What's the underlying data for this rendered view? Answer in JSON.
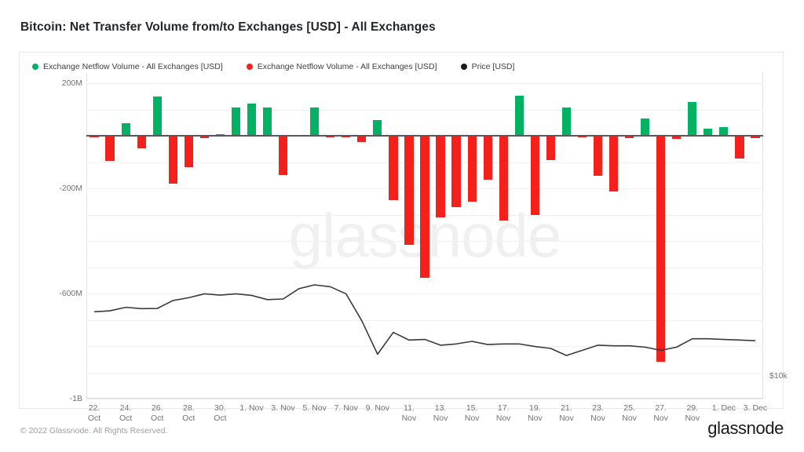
{
  "title": "Bitcoin: Net Transfer Volume from/to Exchanges [USD] - All Exchanges",
  "footer": {
    "copyright": "© 2022 Glassnode. All Rights Reserved.",
    "logo": "glassnode"
  },
  "watermark": "glassnode",
  "legend": [
    {
      "label": "Exchange Netflow Volume - All Exchanges [USD]",
      "color": "#00b262",
      "marker": "circle-dot-icon"
    },
    {
      "label": "Exchange Netflow Volume - All Exchanges [USD]",
      "color": "#f4201c",
      "marker": "circle-dot-icon"
    },
    {
      "label": "Price [USD]",
      "color": "#1c1c1c",
      "marker": "circle-dot-icon"
    }
  ],
  "chart_data": {
    "type": "bar",
    "title": "Bitcoin: Net Transfer Volume from/to Exchanges [USD] - All Exchanges",
    "xlabel": "",
    "ylabel": "",
    "grid": true,
    "legend_position": "top-left",
    "colors": {
      "positive": "#00b262",
      "negative": "#f4201c",
      "price": "#3a3a3a"
    },
    "y_axis": {
      "tick_labels": [
        "200M",
        "-200M",
        "-600M",
        "-1B"
      ],
      "tick_values": [
        200000000,
        -200000000,
        -600000000,
        -1000000000
      ],
      "gridline_values": [
        200000000,
        100000000,
        0,
        -100000000,
        -200000000,
        -300000000,
        -400000000,
        -500000000,
        -600000000,
        -700000000,
        -800000000,
        -900000000,
        -1000000000
      ],
      "ylim": [
        -1000000000,
        240000000
      ],
      "unit": "USD"
    },
    "y_axis_right": {
      "tick_labels": [
        "$10k"
      ],
      "tick_values": [
        10000
      ],
      "unit": "USD",
      "series_name": "Price [USD]"
    },
    "x_axis": {
      "tick_labels": [
        "22. Oct",
        "24. Oct",
        "26. Oct",
        "28. Oct",
        "30. Oct",
        "1. Nov",
        "3. Nov",
        "5. Nov",
        "7. Nov",
        "9. Nov",
        "11. Nov",
        "13. Nov",
        "15. Nov",
        "17. Nov",
        "19. Nov",
        "21. Nov",
        "23. Nov",
        "25. Nov",
        "27. Nov",
        "29. Nov",
        "1. Dec",
        "3. Dec"
      ],
      "tick_indices": [
        0,
        2,
        4,
        6,
        8,
        10,
        12,
        14,
        16,
        18,
        20,
        22,
        24,
        26,
        28,
        30,
        32,
        34,
        36,
        38,
        40,
        42
      ]
    },
    "categories": [
      "22. Oct",
      "23. Oct",
      "24. Oct",
      "25. Oct",
      "26. Oct",
      "27. Oct",
      "28. Oct",
      "29. Oct",
      "30. Oct",
      "31. Oct",
      "1. Nov",
      "2. Nov",
      "3. Nov",
      "4. Nov",
      "5. Nov",
      "6. Nov",
      "7. Nov",
      "8. Nov",
      "9. Nov",
      "10. Nov",
      "11. Nov",
      "12. Nov",
      "13. Nov",
      "14. Nov",
      "15. Nov",
      "16. Nov",
      "17. Nov",
      "18. Nov",
      "19. Nov",
      "20. Nov",
      "21. Nov",
      "22. Nov",
      "23. Nov",
      "24. Nov",
      "25. Nov",
      "26. Nov",
      "27. Nov",
      "28. Nov",
      "29. Nov",
      "30. Nov",
      "1. Dec",
      "2. Dec",
      "3. Dec"
    ],
    "series": [
      {
        "name": "Exchange Netflow Volume - All Exchanges [USD]",
        "type": "bar",
        "values": [
          -2000000,
          -95000000,
          48000000,
          -48000000,
          150000000,
          -182000000,
          -120000000,
          -8000000,
          7000000,
          108000000,
          122000000,
          108000000,
          -148000000,
          4000000,
          108000000,
          -4000000,
          -3000000,
          -22000000,
          62000000,
          -245000000,
          -415000000,
          -540000000,
          -310000000,
          -272000000,
          -250000000,
          -165000000,
          -323000000,
          152000000,
          -300000000,
          -93000000,
          110000000,
          -6000000,
          -150000000,
          -210000000,
          -8000000,
          68000000,
          -860000000,
          -11000000,
          128000000,
          28000000,
          34000000,
          -86000000,
          -9000000
        ]
      },
      {
        "name": "Price [USD]",
        "type": "line",
        "axis": "right",
        "values": [
          19200,
          19280,
          19550,
          19450,
          19460,
          20080,
          20300,
          20600,
          20500,
          20600,
          20480,
          20150,
          20200,
          21000,
          21300,
          21150,
          20600,
          18500,
          15900,
          17600,
          17000,
          17050,
          16600,
          16700,
          16900,
          16650,
          16700,
          16700,
          16500,
          16350,
          15800,
          16200,
          16600,
          16550,
          16550,
          16450,
          16200,
          16450,
          17100,
          17100,
          17050,
          17000,
          16950
        ]
      }
    ]
  }
}
